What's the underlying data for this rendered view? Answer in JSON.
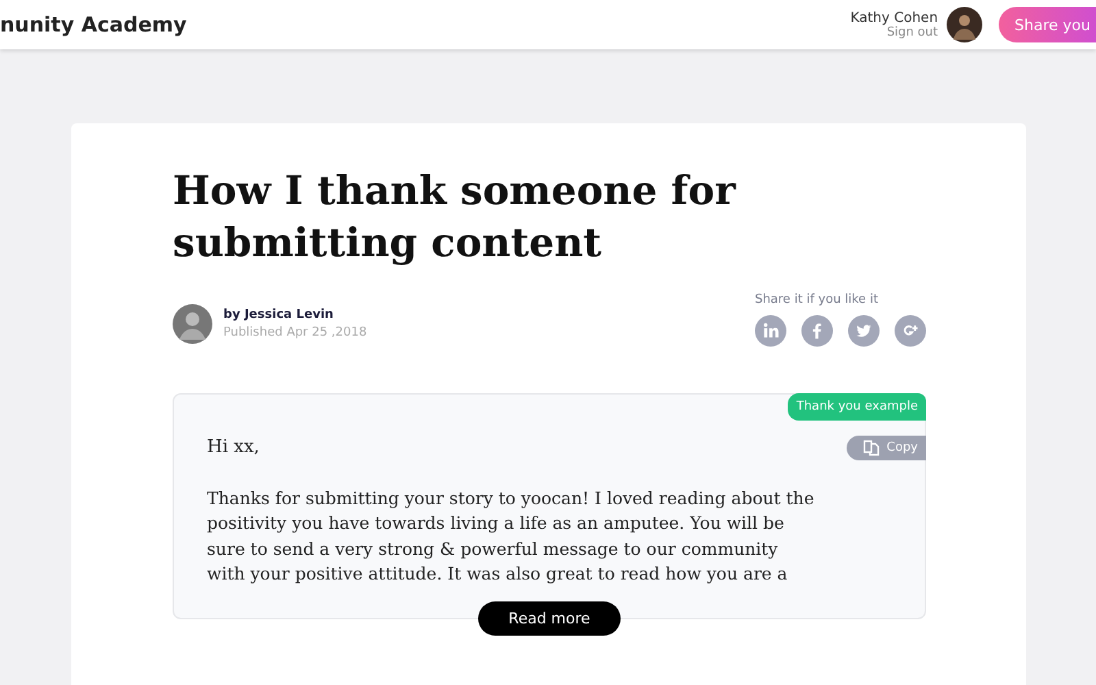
{
  "header": {
    "logo": "nunity Academy",
    "user": {
      "name": "Kathy Cohen",
      "sign_out": "Sign out"
    },
    "share_button": "Share you"
  },
  "article": {
    "title": "How I thank someone for submitting content",
    "author": "by Jessica Levin",
    "published": "Published Apr 25 ,2018",
    "share_label": "Share it if you like it",
    "share_icons": [
      {
        "kind": "linkedin"
      },
      {
        "kind": "facebook"
      },
      {
        "kind": "twitter"
      },
      {
        "kind": "google"
      }
    ],
    "example": {
      "tag": "Thank you example",
      "copy": "Copy",
      "greeting": "Hi xx,",
      "body": "Thanks for submitting your story to yoocan! I loved reading about the positivity you have towards living a life as an amputee. You will be sure to send a very strong & powerful message to our community with your positive attitude. It was also great to read how you are a",
      "read_more": "Read more"
    }
  }
}
